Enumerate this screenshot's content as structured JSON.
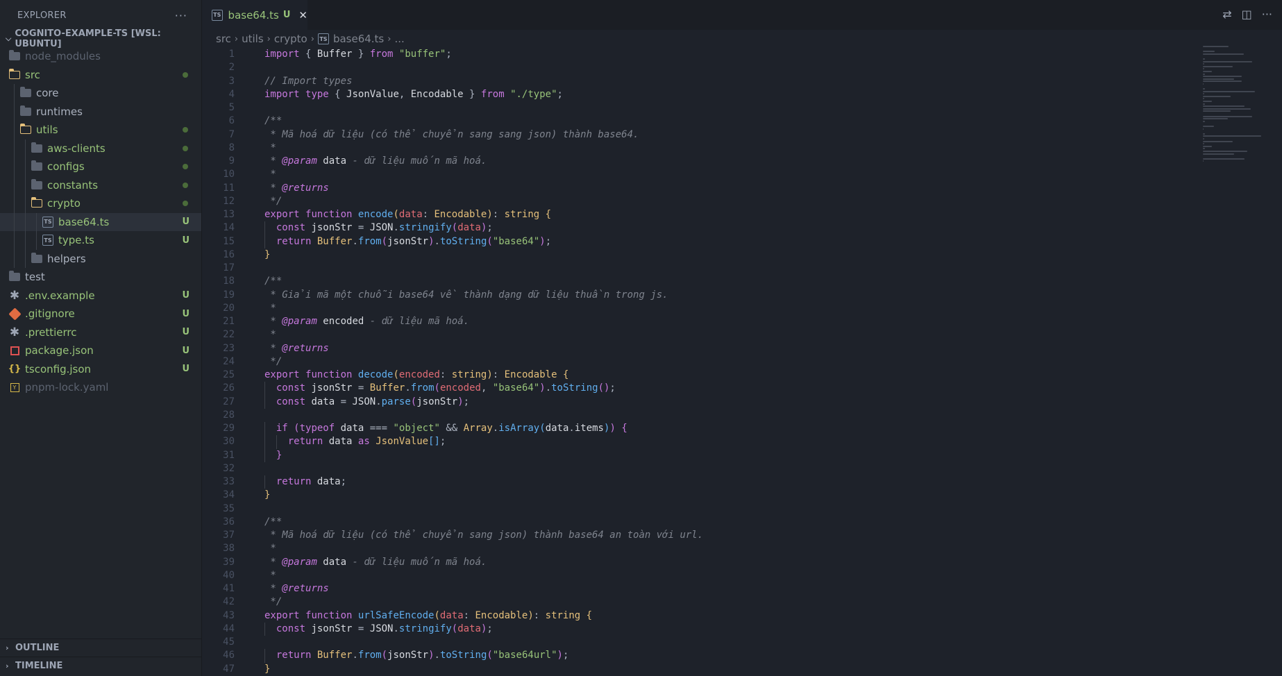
{
  "explorer": {
    "title": "EXPLORER",
    "more": "···",
    "project": "COGNITO-EXAMPLE-TS [WSL: UBUNTU]",
    "items": [
      {
        "label": "node_modules",
        "icon": "folder-closed",
        "depth": 0,
        "color": "dim"
      },
      {
        "label": "src",
        "icon": "folder-open",
        "depth": 0,
        "color": "green",
        "dot": true
      },
      {
        "label": "core",
        "icon": "folder-closed",
        "depth": 1,
        "color": "white"
      },
      {
        "label": "runtimes",
        "icon": "folder-closed",
        "depth": 1,
        "color": "white"
      },
      {
        "label": "utils",
        "icon": "folder-open",
        "depth": 1,
        "color": "green",
        "dot": true
      },
      {
        "label": "aws-clients",
        "icon": "folder-closed",
        "depth": 2,
        "color": "green",
        "dot": true
      },
      {
        "label": "configs",
        "icon": "folder-closed",
        "depth": 2,
        "color": "green",
        "dot": true
      },
      {
        "label": "constants",
        "icon": "folder-closed",
        "depth": 2,
        "color": "green",
        "dot": true
      },
      {
        "label": "crypto",
        "icon": "folder-open",
        "depth": 2,
        "color": "green",
        "dot": true
      },
      {
        "label": "base64.ts",
        "icon": "ts",
        "depth": 3,
        "color": "green",
        "badge": "U",
        "selected": true
      },
      {
        "label": "type.ts",
        "icon": "ts",
        "depth": 3,
        "color": "green",
        "badge": "U"
      },
      {
        "label": "helpers",
        "icon": "folder-closed",
        "depth": 2,
        "color": "white"
      },
      {
        "label": "test",
        "icon": "folder-closed",
        "depth": 0,
        "color": "white"
      },
      {
        "label": ".env.example",
        "icon": "gear",
        "depth": 0,
        "color": "green",
        "badge": "U"
      },
      {
        "label": ".gitignore",
        "icon": "git",
        "depth": 0,
        "color": "green",
        "badge": "U"
      },
      {
        "label": ".prettierrc",
        "icon": "gear",
        "depth": 0,
        "color": "green",
        "badge": "U"
      },
      {
        "label": "package.json",
        "icon": "npm",
        "depth": 0,
        "color": "green",
        "badge": "U"
      },
      {
        "label": "tsconfig.json",
        "icon": "json",
        "depth": 0,
        "color": "green",
        "badge": "U"
      },
      {
        "label": "pnpm-lock.yaml",
        "icon": "yaml",
        "depth": 0,
        "color": "dim"
      }
    ],
    "outline": "OUTLINE",
    "timeline": "TIMELINE"
  },
  "tab": {
    "name": "base64.ts",
    "status": "U",
    "close": "✕",
    "icon": "TS"
  },
  "breadcrumb": [
    "src",
    "utils",
    "crypto",
    "base64.ts",
    "..."
  ],
  "code_lines": [
    [
      [
        "kw",
        "import"
      ],
      [
        "pu",
        " { "
      ],
      [
        "var",
        "Buffer"
      ],
      [
        "pu",
        " } "
      ],
      [
        "kw",
        "from"
      ],
      [
        "pu",
        " "
      ],
      [
        "str",
        "\"buffer\""
      ],
      [
        "pu",
        ";"
      ]
    ],
    [],
    [
      [
        "cm",
        "// Import types"
      ]
    ],
    [
      [
        "kw",
        "import"
      ],
      [
        "pu",
        " "
      ],
      [
        "kw",
        "type"
      ],
      [
        "pu",
        " { "
      ],
      [
        "var",
        "JsonValue"
      ],
      [
        "pu",
        ", "
      ],
      [
        "var",
        "Encodable"
      ],
      [
        "pu",
        " } "
      ],
      [
        "kw",
        "from"
      ],
      [
        "pu",
        " "
      ],
      [
        "str",
        "\"./type\""
      ],
      [
        "pu",
        ";"
      ]
    ],
    [],
    [
      [
        "cm",
        "/**"
      ]
    ],
    [
      [
        "cm",
        " * Mã hoá dữ liệu (có thể chuyển sang sang json) thành base64."
      ]
    ],
    [
      [
        "cm",
        " *"
      ]
    ],
    [
      [
        "cm",
        " * "
      ],
      [
        "tag",
        "@param"
      ],
      [
        "var",
        " data"
      ],
      [
        "cm",
        " - dữ liệu muốn mã hoá."
      ]
    ],
    [
      [
        "cm",
        " *"
      ]
    ],
    [
      [
        "cm",
        " * "
      ],
      [
        "tag",
        "@returns"
      ]
    ],
    [
      [
        "cm",
        " */"
      ]
    ],
    [
      [
        "kw",
        "export"
      ],
      [
        "pu",
        " "
      ],
      [
        "kw",
        "function"
      ],
      [
        "pu",
        " "
      ],
      [
        "fn",
        "encode"
      ],
      [
        "b1",
        "("
      ],
      [
        "param",
        "data"
      ],
      [
        "pu",
        ": "
      ],
      [
        "type",
        "Encodable"
      ],
      [
        "b1",
        ")"
      ],
      [
        "pu",
        ": "
      ],
      [
        "type",
        "string"
      ],
      [
        "pu",
        " "
      ],
      [
        "b1",
        "{"
      ]
    ],
    [
      [
        "pu",
        "  "
      ],
      [
        "kw",
        "const"
      ],
      [
        "pu",
        " "
      ],
      [
        "var",
        "jsonStr"
      ],
      [
        "pu",
        " = "
      ],
      [
        "var",
        "JSON"
      ],
      [
        "pu",
        "."
      ],
      [
        "fn",
        "stringify"
      ],
      [
        "b2",
        "("
      ],
      [
        "param",
        "data"
      ],
      [
        "b2",
        ")"
      ],
      [
        "pu",
        ";"
      ]
    ],
    [
      [
        "pu",
        "  "
      ],
      [
        "kw",
        "return"
      ],
      [
        "pu",
        " "
      ],
      [
        "type",
        "Buffer"
      ],
      [
        "pu",
        "."
      ],
      [
        "fn",
        "from"
      ],
      [
        "b2",
        "("
      ],
      [
        "var",
        "jsonStr"
      ],
      [
        "b2",
        ")"
      ],
      [
        "pu",
        "."
      ],
      [
        "fn",
        "toString"
      ],
      [
        "b2",
        "("
      ],
      [
        "str",
        "\"base64\""
      ],
      [
        "b2",
        ")"
      ],
      [
        "pu",
        ";"
      ]
    ],
    [
      [
        "b1",
        "}"
      ]
    ],
    [],
    [
      [
        "cm",
        "/**"
      ]
    ],
    [
      [
        "cm",
        " * Giải mã một chuỗi base64 về thành dạng dữ liệu thuần trong js."
      ]
    ],
    [
      [
        "cm",
        " *"
      ]
    ],
    [
      [
        "cm",
        " * "
      ],
      [
        "tag",
        "@param"
      ],
      [
        "var",
        " encoded"
      ],
      [
        "cm",
        " - dữ liệu mã hoá."
      ]
    ],
    [
      [
        "cm",
        " *"
      ]
    ],
    [
      [
        "cm",
        " * "
      ],
      [
        "tag",
        "@returns"
      ]
    ],
    [
      [
        "cm",
        " */"
      ]
    ],
    [
      [
        "kw",
        "export"
      ],
      [
        "pu",
        " "
      ],
      [
        "kw",
        "function"
      ],
      [
        "pu",
        " "
      ],
      [
        "fn",
        "decode"
      ],
      [
        "b1",
        "("
      ],
      [
        "param",
        "encoded"
      ],
      [
        "pu",
        ": "
      ],
      [
        "type",
        "string"
      ],
      [
        "b1",
        ")"
      ],
      [
        "pu",
        ": "
      ],
      [
        "type",
        "Encodable"
      ],
      [
        "pu",
        " "
      ],
      [
        "b1",
        "{"
      ]
    ],
    [
      [
        "pu",
        "  "
      ],
      [
        "kw",
        "const"
      ],
      [
        "pu",
        " "
      ],
      [
        "var",
        "jsonStr"
      ],
      [
        "pu",
        " = "
      ],
      [
        "type",
        "Buffer"
      ],
      [
        "pu",
        "."
      ],
      [
        "fn",
        "from"
      ],
      [
        "b2",
        "("
      ],
      [
        "param",
        "encoded"
      ],
      [
        "pu",
        ", "
      ],
      [
        "str",
        "\"base64\""
      ],
      [
        "b2",
        ")"
      ],
      [
        "pu",
        "."
      ],
      [
        "fn",
        "toString"
      ],
      [
        "b2",
        "()"
      ],
      [
        "pu",
        ";"
      ]
    ],
    [
      [
        "pu",
        "  "
      ],
      [
        "kw",
        "const"
      ],
      [
        "pu",
        " "
      ],
      [
        "var",
        "data"
      ],
      [
        "pu",
        " = "
      ],
      [
        "var",
        "JSON"
      ],
      [
        "pu",
        "."
      ],
      [
        "fn",
        "parse"
      ],
      [
        "b2",
        "("
      ],
      [
        "var",
        "jsonStr"
      ],
      [
        "b2",
        ")"
      ],
      [
        "pu",
        ";"
      ]
    ],
    [],
    [
      [
        "pu",
        "  "
      ],
      [
        "kw",
        "if"
      ],
      [
        "pu",
        " "
      ],
      [
        "b2",
        "("
      ],
      [
        "kw",
        "typeof"
      ],
      [
        "pu",
        " "
      ],
      [
        "var",
        "data"
      ],
      [
        "pu",
        " === "
      ],
      [
        "str",
        "\"object\""
      ],
      [
        "pu",
        " && "
      ],
      [
        "type",
        "Array"
      ],
      [
        "pu",
        "."
      ],
      [
        "fn",
        "isArray"
      ],
      [
        "b3",
        "("
      ],
      [
        "var",
        "data"
      ],
      [
        "pu",
        "."
      ],
      [
        "var",
        "items"
      ],
      [
        "b3",
        ")"
      ],
      [
        "b2",
        ")"
      ],
      [
        "pu",
        " "
      ],
      [
        "b2",
        "{"
      ]
    ],
    [
      [
        "pu",
        "    "
      ],
      [
        "kw",
        "return"
      ],
      [
        "pu",
        " "
      ],
      [
        "var",
        "data"
      ],
      [
        "pu",
        " "
      ],
      [
        "kw",
        "as"
      ],
      [
        "pu",
        " "
      ],
      [
        "type",
        "JsonValue"
      ],
      [
        "b3",
        "[]"
      ],
      [
        "pu",
        ";"
      ]
    ],
    [
      [
        "pu",
        "  "
      ],
      [
        "b2",
        "}"
      ]
    ],
    [],
    [
      [
        "pu",
        "  "
      ],
      [
        "kw",
        "return"
      ],
      [
        "pu",
        " "
      ],
      [
        "var",
        "data"
      ],
      [
        "pu",
        ";"
      ]
    ],
    [
      [
        "b1",
        "}"
      ]
    ],
    [],
    [
      [
        "cm",
        "/**"
      ]
    ],
    [
      [
        "cm",
        " * Mã hoá dữ liệu (có thể chuyển sang json) thành base64 an toàn với url."
      ]
    ],
    [
      [
        "cm",
        " *"
      ]
    ],
    [
      [
        "cm",
        " * "
      ],
      [
        "tag",
        "@param"
      ],
      [
        "var",
        " data"
      ],
      [
        "cm",
        " - dữ liệu muốn mã hoá."
      ]
    ],
    [
      [
        "cm",
        " *"
      ]
    ],
    [
      [
        "cm",
        " * "
      ],
      [
        "tag",
        "@returns"
      ]
    ],
    [
      [
        "cm",
        " */"
      ]
    ],
    [
      [
        "kw",
        "export"
      ],
      [
        "pu",
        " "
      ],
      [
        "kw",
        "function"
      ],
      [
        "pu",
        " "
      ],
      [
        "fn",
        "urlSafeEncode"
      ],
      [
        "b1",
        "("
      ],
      [
        "param",
        "data"
      ],
      [
        "pu",
        ": "
      ],
      [
        "type",
        "Encodable"
      ],
      [
        "b1",
        ")"
      ],
      [
        "pu",
        ": "
      ],
      [
        "type",
        "string"
      ],
      [
        "pu",
        " "
      ],
      [
        "b1",
        "{"
      ]
    ],
    [
      [
        "pu",
        "  "
      ],
      [
        "kw",
        "const"
      ],
      [
        "pu",
        " "
      ],
      [
        "var",
        "jsonStr"
      ],
      [
        "pu",
        " = "
      ],
      [
        "var",
        "JSON"
      ],
      [
        "pu",
        "."
      ],
      [
        "fn",
        "stringify"
      ],
      [
        "b2",
        "("
      ],
      [
        "param",
        "data"
      ],
      [
        "b2",
        ")"
      ],
      [
        "pu",
        ";"
      ]
    ],
    [],
    [
      [
        "pu",
        "  "
      ],
      [
        "kw",
        "return"
      ],
      [
        "pu",
        " "
      ],
      [
        "type",
        "Buffer"
      ],
      [
        "pu",
        "."
      ],
      [
        "fn",
        "from"
      ],
      [
        "b2",
        "("
      ],
      [
        "var",
        "jsonStr"
      ],
      [
        "b2",
        ")"
      ],
      [
        "pu",
        "."
      ],
      [
        "fn",
        "toString"
      ],
      [
        "b2",
        "("
      ],
      [
        "str",
        "\"base64url\""
      ],
      [
        "b2",
        ")"
      ],
      [
        "pu",
        ";"
      ]
    ],
    [
      [
        "b1",
        "}"
      ]
    ]
  ]
}
